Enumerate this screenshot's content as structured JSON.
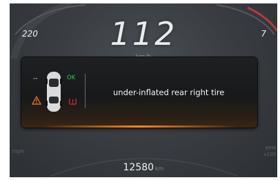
{
  "dashboard": {
    "speed": "112",
    "speed_unit": "km/h",
    "left_speed_mark": "220",
    "right_rpm_mark": "7",
    "left_gauge_unit": "mph",
    "rpm_label_top": "RPM",
    "rpm_label_bottom": "x100",
    "odometer_value": "12580",
    "odometer_unit": "km"
  },
  "tire_warning": {
    "message": "under-inflated rear right tire",
    "front_left_status": "--",
    "front_right_status": "OK",
    "warning_color": "#e06a1c",
    "ok_color": "#36c94c",
    "alert_color": "#e0262a"
  }
}
